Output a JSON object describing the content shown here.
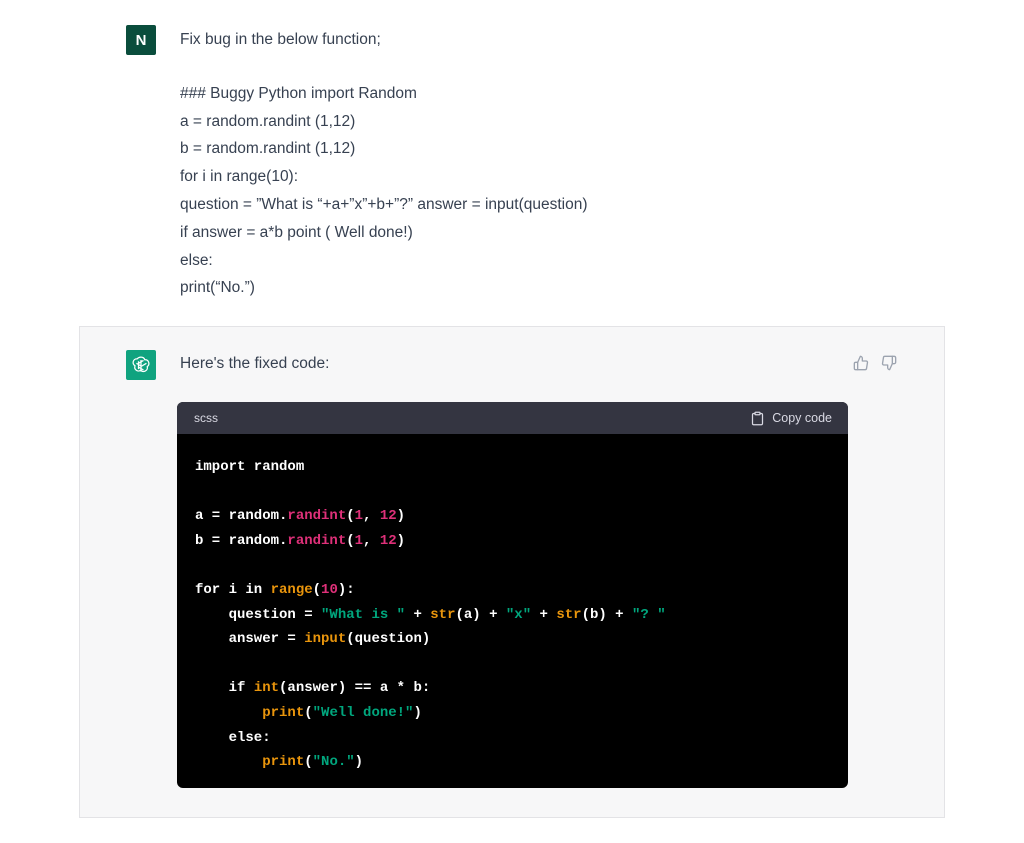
{
  "user": {
    "avatar_letter": "N",
    "message_lines": [
      "Fix bug in the below function;",
      "",
      "### Buggy Python import Random",
      "a = random.randint (1,12)",
      "b = random.randint (1,12)",
      "for i in range(10):",
      "question = ”What is “+a+”x”+b+”?” answer = input(question)",
      "if answer = a*b point ( Well done!)",
      "else:",
      "print(“No.”)"
    ]
  },
  "assistant": {
    "intro": "Here's the fixed code:",
    "feedback": {
      "thumbs_up_icon": "thumbs-up-icon",
      "thumbs_down_icon": "thumbs-down-icon"
    },
    "code_block": {
      "language": "scss",
      "copy_label": "Copy code",
      "lines": [
        [
          {
            "t": "import random",
            "c": "plain"
          }
        ],
        [],
        [
          {
            "t": "a = random.",
            "c": "plain"
          },
          {
            "t": "randint",
            "c": "fn"
          },
          {
            "t": "(",
            "c": "plain"
          },
          {
            "t": "1",
            "c": "num"
          },
          {
            "t": ", ",
            "c": "plain"
          },
          {
            "t": "12",
            "c": "num"
          },
          {
            "t": ")",
            "c": "plain"
          }
        ],
        [
          {
            "t": "b = random.",
            "c": "plain"
          },
          {
            "t": "randint",
            "c": "fn"
          },
          {
            "t": "(",
            "c": "plain"
          },
          {
            "t": "1",
            "c": "num"
          },
          {
            "t": ", ",
            "c": "plain"
          },
          {
            "t": "12",
            "c": "num"
          },
          {
            "t": ")",
            "c": "plain"
          }
        ],
        [],
        [
          {
            "t": "for i in ",
            "c": "plain"
          },
          {
            "t": "range",
            "c": "builtin"
          },
          {
            "t": "(",
            "c": "plain"
          },
          {
            "t": "10",
            "c": "num"
          },
          {
            "t": "):",
            "c": "plain"
          }
        ],
        [
          {
            "t": "    question = ",
            "c": "plain"
          },
          {
            "t": "\"What is \"",
            "c": "str"
          },
          {
            "t": " + ",
            "c": "plain"
          },
          {
            "t": "str",
            "c": "builtin"
          },
          {
            "t": "(a) + ",
            "c": "plain"
          },
          {
            "t": "\"x\"",
            "c": "str"
          },
          {
            "t": " + ",
            "c": "plain"
          },
          {
            "t": "str",
            "c": "builtin"
          },
          {
            "t": "(b) + ",
            "c": "plain"
          },
          {
            "t": "\"? \"",
            "c": "str"
          }
        ],
        [
          {
            "t": "    answer = ",
            "c": "plain"
          },
          {
            "t": "input",
            "c": "builtin"
          },
          {
            "t": "(question)",
            "c": "plain"
          }
        ],
        [],
        [
          {
            "t": "    if ",
            "c": "plain"
          },
          {
            "t": "int",
            "c": "builtin"
          },
          {
            "t": "(answer) == a * b:",
            "c": "plain"
          }
        ],
        [
          {
            "t": "        ",
            "c": "plain"
          },
          {
            "t": "print",
            "c": "builtin"
          },
          {
            "t": "(",
            "c": "plain"
          },
          {
            "t": "\"Well done!\"",
            "c": "str"
          },
          {
            "t": ")",
            "c": "plain"
          }
        ],
        [
          {
            "t": "    else:",
            "c": "plain"
          }
        ],
        [
          {
            "t": "        ",
            "c": "plain"
          },
          {
            "t": "print",
            "c": "builtin"
          },
          {
            "t": "(",
            "c": "plain"
          },
          {
            "t": "\"No.\"",
            "c": "str"
          },
          {
            "t": ")",
            "c": "plain"
          }
        ]
      ]
    }
  },
  "colors": {
    "user_avatar_bg": "#0a4d3c",
    "assistant_avatar_bg": "#10a37f",
    "assistant_row_bg": "#f7f7f8",
    "code_bg": "#000000",
    "code_header_bg": "#343541",
    "token_fn": "#df3079",
    "token_builtin": "#e9950c",
    "token_string": "#00a67d"
  }
}
